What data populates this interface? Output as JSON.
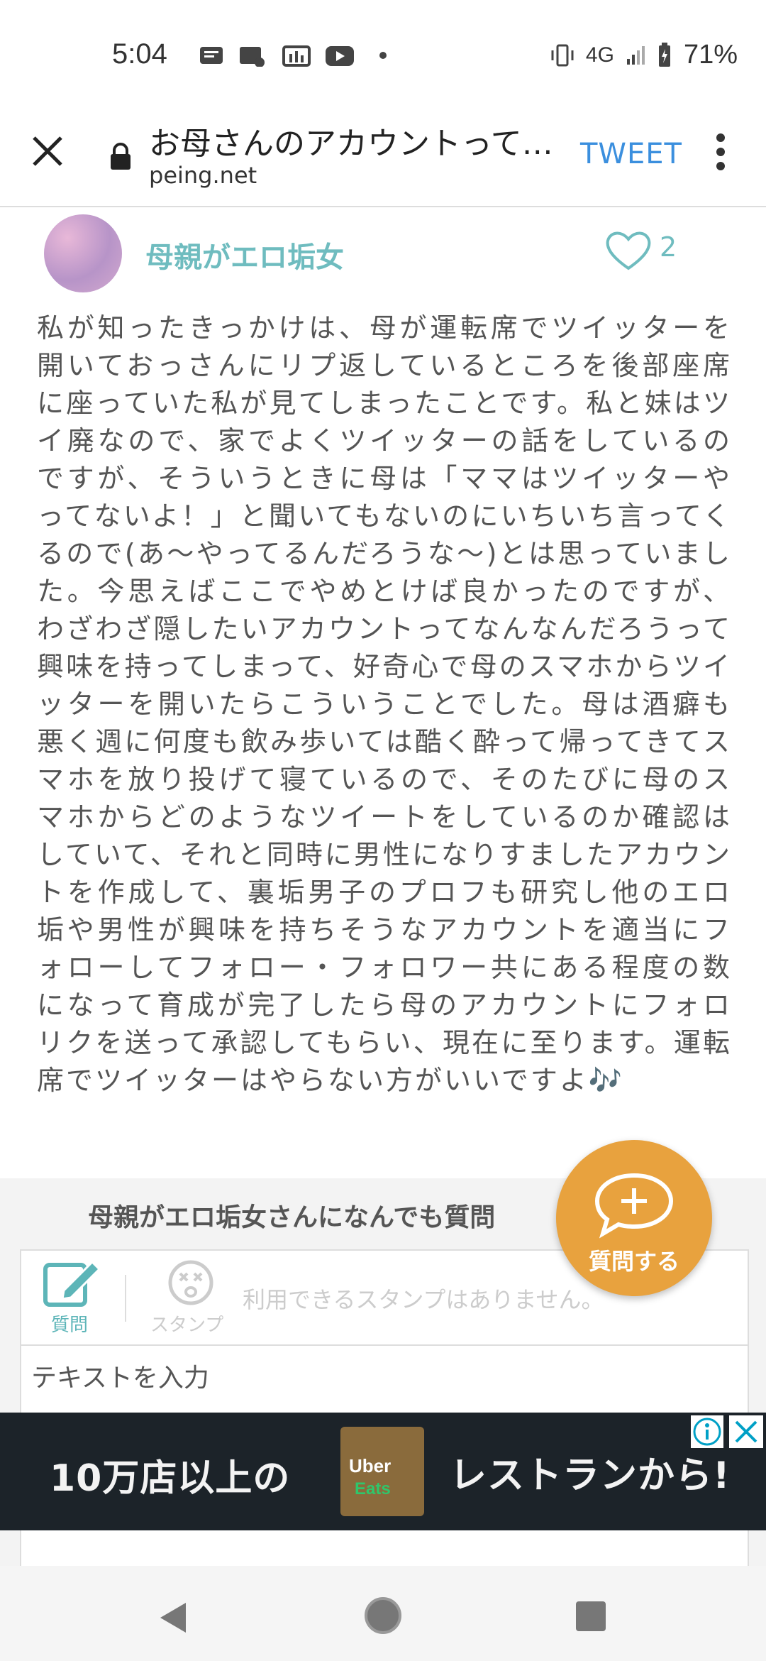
{
  "status_bar": {
    "time": "5:04",
    "network": "4G",
    "battery": "71%"
  },
  "browser": {
    "page_title": "お母さんのアカウントって…",
    "host": "peing.net",
    "tweet_label": "TWEET"
  },
  "profile": {
    "username": "母親がエロ垢女",
    "like_count": "2"
  },
  "answer_text": "私が知ったきっかけは、母が運転席でツイッターを開いておっさんにリプ返しているところを後部座席に座っていた私が見てしまったことです。私と妹はツイ廃なので、家でよくツイッターの話をしているのですが、そういうときに母は「ママはツイッターやってないよ！」と聞いてもないのにいちいち言ってくるので(あ〜やってるんだろうな〜)とは思っていました。今思えばここでやめとけば良かったのですが、わざわざ隠したいアカウントってなんなんだろうって興味を持ってしまって、好奇心で母のスマホからツイッターを開いたらこういうことでした。母は酒癖も悪く週に何度も飲み歩いては酷く酔って帰ってきてスマホを放り投げて寝ているので、そのたびに母のスマホからどのようなツイートをしているのか確認はしていて、それと同時に男性になりすましたアカウントを作成して、裏垢男子のプロフも研究し他のエロ垢や男性が興味を持ちそうなアカウントを適当にフォローしてフォロー・フォロワー共にある程度の数になって育成が完了したら母のアカウントにフォロリクを送って承認してもらい、現在に至ります。運転席でツイッターはやらない方がいいですよ🎶",
  "ask": {
    "title": "母親がエロ垢女さんになんでも質問",
    "tool_question_label": "質問",
    "tool_stamp_label": "スタンプ",
    "stamp_message": "利用できるスタンプはありません。",
    "input_placeholder": "テキストを入力",
    "fab_label": "質問する"
  },
  "ad": {
    "left_text": "10万店以上の",
    "right_text": "レストランから!",
    "logo_line1": "Uber",
    "logo_line2": "Eats"
  },
  "colors": {
    "accent_teal": "#6fbcbf",
    "fab_orange": "#e8a23e",
    "tweet_blue": "#3b8fde",
    "ad_bg": "#1c2329"
  }
}
